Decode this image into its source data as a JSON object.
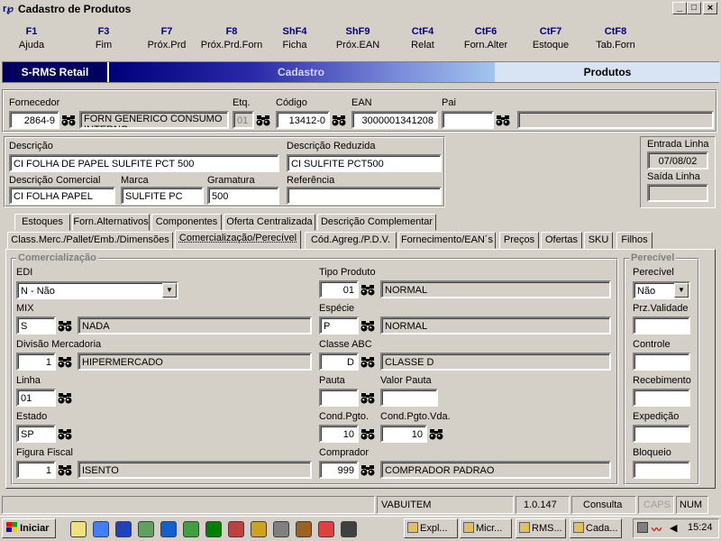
{
  "window": {
    "title": "Cadastro de Produtos",
    "controls": {
      "min": "_",
      "max": "□",
      "close": "×"
    }
  },
  "fkeys": [
    {
      "key": "F1",
      "label": "Ajuda"
    },
    {
      "key": "F3",
      "label": "Fim"
    },
    {
      "key": "F7",
      "label": "Próx.Prd"
    },
    {
      "key": "F8",
      "label": "Próx.Prd.Forn"
    },
    {
      "key": "ShF4",
      "label": "Ficha"
    },
    {
      "key": "ShF9",
      "label": "Próx.EAN"
    },
    {
      "key": "CtF4",
      "label": "Relat"
    },
    {
      "key": "CtF6",
      "label": "Forn.Alter"
    },
    {
      "key": "CtF7",
      "label": "Estoque"
    },
    {
      "key": "CtF8",
      "label": "Tab.Forn"
    }
  ],
  "banner": {
    "app": "S-RMS Retail",
    "mode": "Cadastro",
    "entity": "Produtos"
  },
  "top": {
    "fornecedor_label": "Fornecedor",
    "fornecedor_code": "2864-9",
    "fornecedor_name": "FORN GENERICO CONSUMO INTERNO",
    "etq_label": "Etq.",
    "etq": "01",
    "codigo_label": "Código",
    "codigo": "13412-0",
    "ean_label": "EAN",
    "ean": "3000001341208",
    "pai_label": "Pai",
    "pai": "",
    "pai_desc": ""
  },
  "desc": {
    "descricao_label": "Descrição",
    "descricao": "CI FOLHA DE PAPEL SULFITE PCT 500",
    "reduzida_label": "Descrição Reduzida",
    "reduzida": "CI SULFITE PCT500",
    "comercial_label": "Descrição Comercial",
    "comercial": "CI FOLHA PAPEL",
    "marca_label": "Marca",
    "marca": "SULFITE PC",
    "gramatura_label": "Gramatura",
    "gramatura": "500",
    "referencia_label": "Referência",
    "referencia": ""
  },
  "linha": {
    "entrada_label": "Entrada Linha",
    "entrada": "07/08/02",
    "saida_label": "Saída Linha",
    "saida": ""
  },
  "tabs_row1": [
    "Estoques",
    "Forn.Alternativos",
    "Componentes",
    "Oferta Centralizada",
    "Descrição Complementar"
  ],
  "tabs_row2": [
    "Class.Merc./Pallet/Emb./Dimensões",
    "Comercialização/Perecível",
    "Cód.Agreg./P.D.V.",
    "Fornecimento/EAN´s",
    "Preços",
    "Ofertas",
    "SKU",
    "Filhos"
  ],
  "comercializacao": {
    "title": "Comercialização",
    "edi_label": "EDI",
    "edi": "N - Não",
    "mix_label": "MIX",
    "mix_code": "S",
    "mix_desc": "NADA",
    "divisao_label": "Divisão Mercadoria",
    "divisao_code": "1",
    "divisao_desc": "HIPERMERCADO",
    "linha_label": "Linha",
    "linha_code": "01",
    "estado_label": "Estado",
    "estado_code": "SP",
    "figura_label": "Figura Fiscal",
    "figura_code": "1",
    "figura_desc": "ISENTO",
    "tipo_label": "Tipo Produto",
    "tipo_code": "01",
    "tipo_desc": "NORMAL",
    "especie_label": "Espécie",
    "especie_code": "P",
    "especie_desc": "NORMAL",
    "classe_label": "Classe ABC",
    "classe_code": "D",
    "classe_desc": "CLASSE D",
    "pauta_label": "Pauta",
    "pauta": "",
    "valor_pauta_label": "Valor Pauta",
    "valor_pauta": "",
    "cond_label": "Cond.Pgto.",
    "cond": "10",
    "cond_vda_label": "Cond.Pgto.Vda.",
    "cond_vda": "10",
    "comprador_label": "Comprador",
    "comprador_code": "999",
    "comprador_desc": "COMPRADOR PADRAO"
  },
  "perecivel": {
    "title": "Perecível",
    "perecivel_label": "Perecível",
    "perecivel": "Não",
    "validade_label": "Prz.Validade",
    "controle_label": "Controle",
    "recebimento_label": "Recebimento",
    "expedicao_label": "Expedição",
    "bloqueio_label": "Bloqueio"
  },
  "status": {
    "user": "VABUITEM",
    "version": "1.0.147",
    "mode": "Consulta",
    "caps": "CAPS",
    "num": "NUM"
  },
  "taskbar": {
    "start": "Iniciar",
    "tasks": [
      "Expl...",
      "Micr...",
      "RMS...",
      "Cada..."
    ],
    "time": "15:24"
  },
  "colors": {
    "titlebar": "#d4d0c8",
    "banner_dark": "#00007c",
    "banner_light": "#a6caf0",
    "fkey": "#000080"
  }
}
